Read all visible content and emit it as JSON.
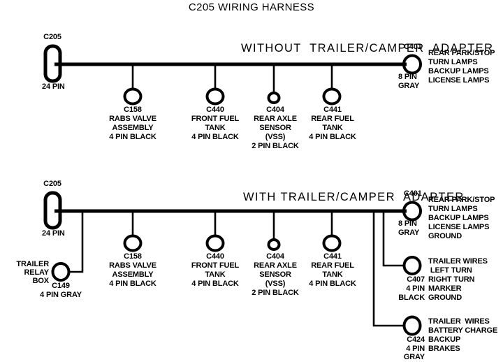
{
  "title": "C205 WIRING HARNESS",
  "sections": [
    {
      "id": "without-adapter",
      "heading": "WITHOUT  TRAILER/CAMPER  ADAPTER",
      "source": {
        "id": "C205",
        "pins": "24 PIN",
        "shape": "rounded-rect"
      },
      "branches": [
        {
          "id": "C158",
          "lines": [
            "RABS VALVE",
            "ASSEMBLY",
            "4 PIN BLACK"
          ],
          "shape": "circle"
        },
        {
          "id": "C440",
          "lines": [
            "FRONT FUEL",
            "TANK",
            "4 PIN BLACK"
          ],
          "shape": "circle"
        },
        {
          "id": "C404",
          "lines": [
            "REAR AXLE",
            "SENSOR",
            "(VSS)",
            "2 PIN BLACK"
          ],
          "shape": "circle-small"
        },
        {
          "id": "C441",
          "lines": [
            "REAR FUEL",
            "TANK",
            "4 PIN BLACK"
          ],
          "shape": "circle"
        }
      ],
      "terminal": {
        "id": "C401",
        "pins": "8 PIN",
        "color": "GRAY",
        "functions": [
          "REAR PARK/STOP",
          "TURN LAMPS",
          "BACKUP LAMPS",
          "LICENSE LAMPS"
        ]
      }
    },
    {
      "id": "with-adapter",
      "heading": "WITH TRAILER/CAMPER  ADAPTER",
      "source": {
        "id": "C205",
        "pins": "24 PIN",
        "shape": "rounded-rect"
      },
      "relay": {
        "name_lines": [
          "TRAILER",
          "RELAY",
          "BOX"
        ],
        "id": "C149",
        "pins": "4 PIN GRAY",
        "shape": "circle"
      },
      "branches": [
        {
          "id": "C158",
          "lines": [
            "RABS VALVE",
            "ASSEMBLY",
            "4 PIN BLACK"
          ],
          "shape": "circle"
        },
        {
          "id": "C440",
          "lines": [
            "FRONT FUEL",
            "TANK",
            "4 PIN BLACK"
          ],
          "shape": "circle"
        },
        {
          "id": "C404",
          "lines": [
            "REAR AXLE",
            "SENSOR",
            "(VSS)",
            "2 PIN BLACK"
          ],
          "shape": "circle-small"
        },
        {
          "id": "C441",
          "lines": [
            "REAR FUEL",
            "TANK",
            "4 PIN BLACK"
          ],
          "shape": "circle"
        }
      ],
      "terminals": [
        {
          "id": "C401",
          "pins": "8 PIN",
          "color": "GRAY",
          "functions": [
            "REAR PARK/STOP",
            "TURN LAMPS",
            "BACKUP LAMPS",
            "LICENSE LAMPS",
            "GROUND"
          ]
        },
        {
          "id": "C407",
          "pins": "4 PIN",
          "color": "BLACK",
          "functions": [
            "TRAILER WIRES",
            " LEFT TURN",
            "RIGHT TURN",
            "MARKER",
            "GROUND"
          ]
        },
        {
          "id": "C424",
          "pins": "4 PIN",
          "color": "GRAY",
          "functions": [
            "TRAILER  WIRES",
            "BATTERY CHARGE",
            "BACKUP",
            "BRAKES"
          ]
        }
      ]
    }
  ],
  "style": {
    "ink": "#000000",
    "paper": "#ffffff"
  }
}
